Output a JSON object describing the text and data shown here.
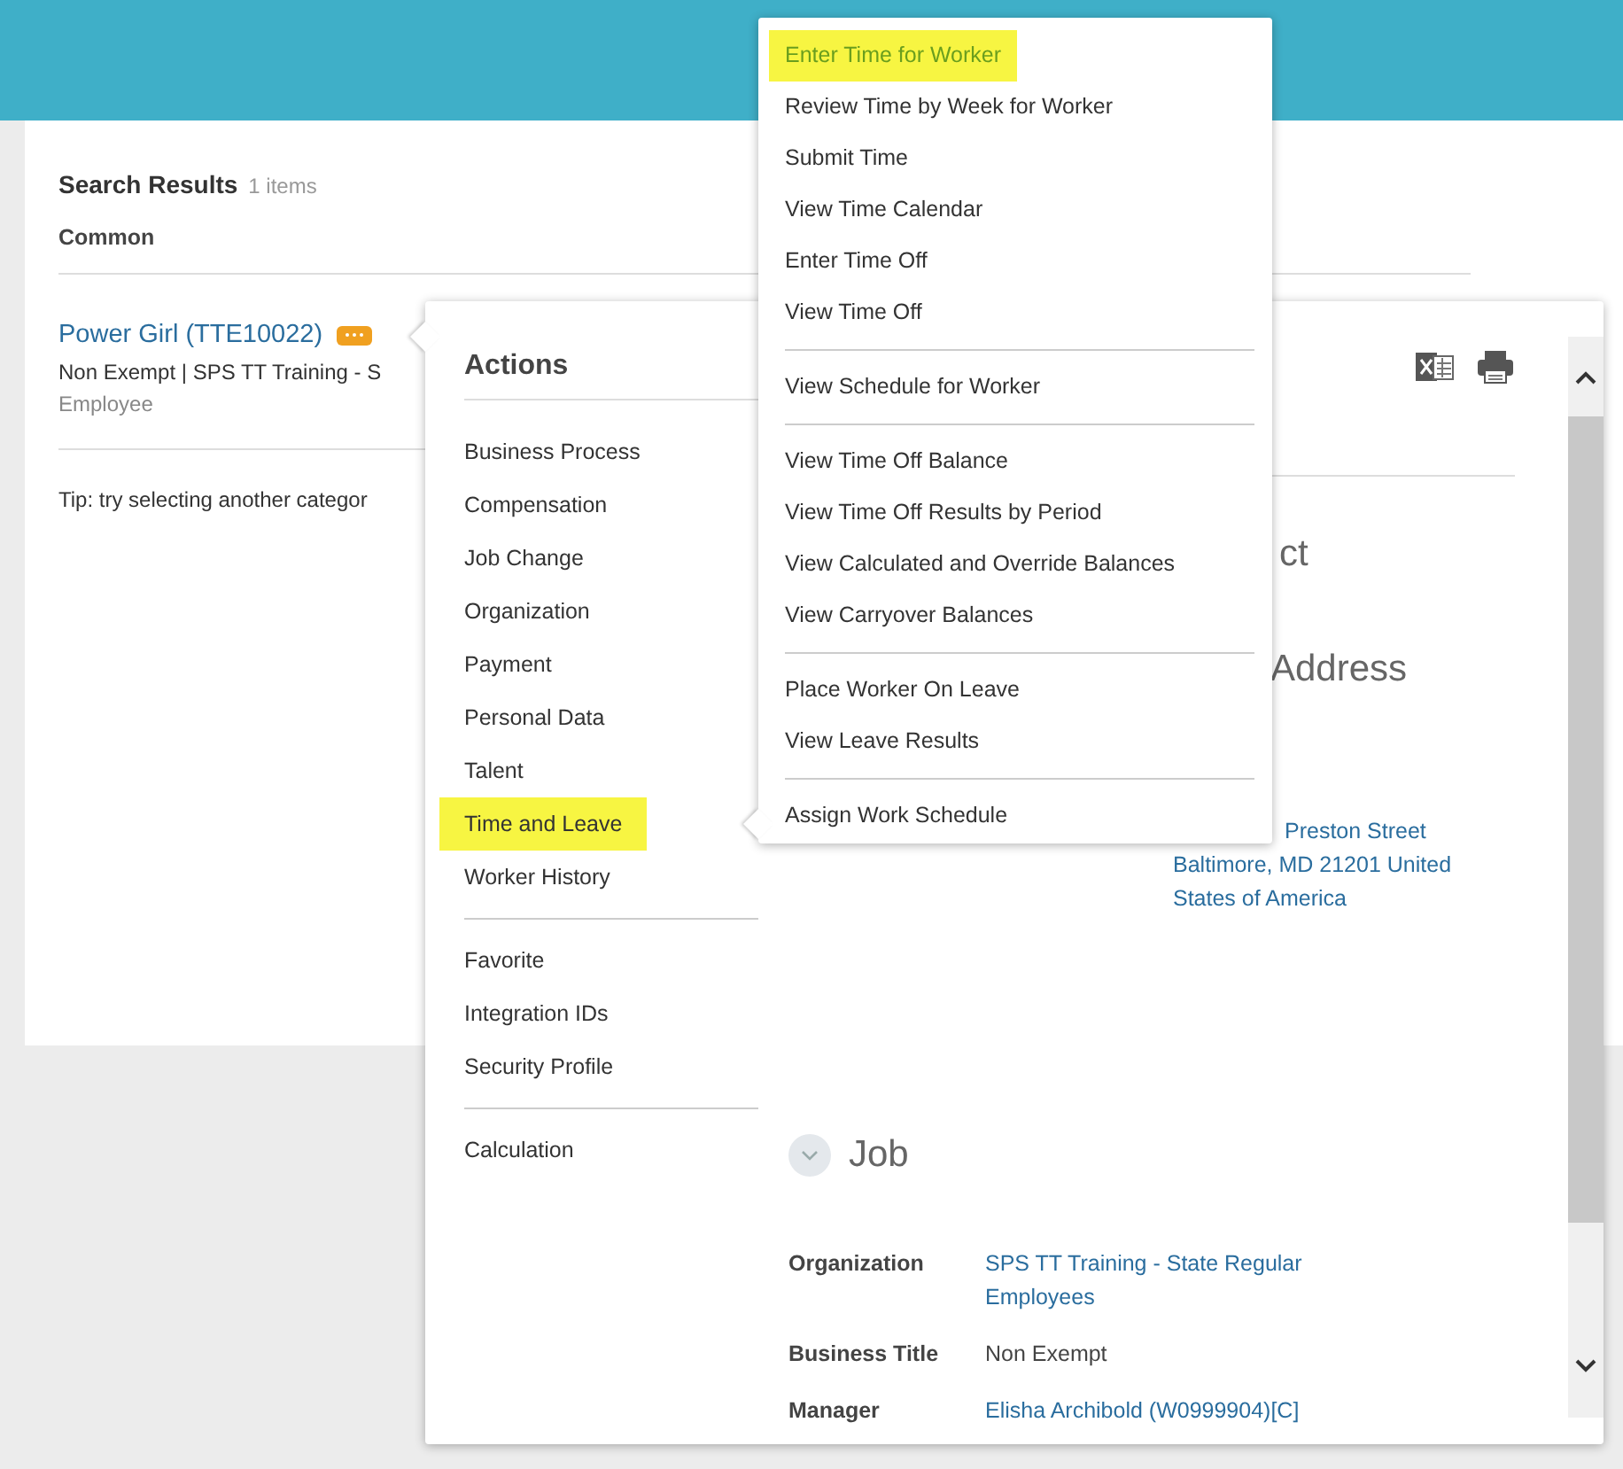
{
  "search_results": {
    "title": "Search Results",
    "count": "1 items",
    "category": "Common",
    "result": {
      "name": "Power Girl (TTE10022)",
      "subtitle": "Non Exempt | SPS TT Training - S",
      "type": "Employee"
    },
    "tip": "Tip: try selecting another categor"
  },
  "actions_popup": {
    "title": "Actions",
    "groups": [
      [
        {
          "label": "Business Process",
          "selected": false
        },
        {
          "label": "Compensation",
          "selected": false
        },
        {
          "label": "Job Change",
          "selected": false
        },
        {
          "label": "Organization",
          "selected": false
        },
        {
          "label": "Payment",
          "selected": false
        },
        {
          "label": "Personal Data",
          "selected": false
        },
        {
          "label": "Talent",
          "selected": false
        },
        {
          "label": "Time and Leave",
          "selected": true
        },
        {
          "label": "Worker History",
          "selected": false
        }
      ],
      [
        {
          "label": "Favorite",
          "selected": false
        },
        {
          "label": "Integration IDs",
          "selected": false
        },
        {
          "label": "Security Profile",
          "selected": false
        }
      ],
      [
        {
          "label": "Calculation",
          "selected": false
        }
      ]
    ]
  },
  "submenu": {
    "groups": [
      [
        {
          "label": "Enter Time for Worker",
          "selected": true
        },
        {
          "label": "Review Time by Week for Worker",
          "selected": false
        },
        {
          "label": "Submit Time",
          "selected": false
        },
        {
          "label": "View Time Calendar",
          "selected": false
        },
        {
          "label": "Enter Time Off",
          "selected": false
        },
        {
          "label": "View Time Off",
          "selected": false
        }
      ],
      [
        {
          "label": "View Schedule for Worker",
          "selected": false
        }
      ],
      [
        {
          "label": "View Time Off Balance",
          "selected": false
        },
        {
          "label": "View Time Off Results by Period",
          "selected": false
        },
        {
          "label": "View Calculated and Override Balances",
          "selected": false
        },
        {
          "label": "View Carryover Balances",
          "selected": false
        }
      ],
      [
        {
          "label": "Place Worker On Leave",
          "selected": false
        },
        {
          "label": "View Leave Results",
          "selected": false
        }
      ],
      [
        {
          "label": "Assign Work Schedule",
          "selected": false
        }
      ]
    ]
  },
  "worker_panel": {
    "contact_fragment": "ct",
    "address_fragment": "Address",
    "address_lines": [
      "Preston Street",
      "Baltimore, MD 21201 United",
      "States of America"
    ],
    "job": {
      "title": "Job",
      "fields": [
        {
          "label": "Organization",
          "value": "SPS TT Training - State Regular Employees",
          "kind": "link"
        },
        {
          "label": "Business Title",
          "value": "Non Exempt",
          "kind": "text"
        },
        {
          "label": "Manager",
          "value": "Elisha Archibold (W0999904)[C]",
          "kind": "link"
        }
      ]
    }
  }
}
